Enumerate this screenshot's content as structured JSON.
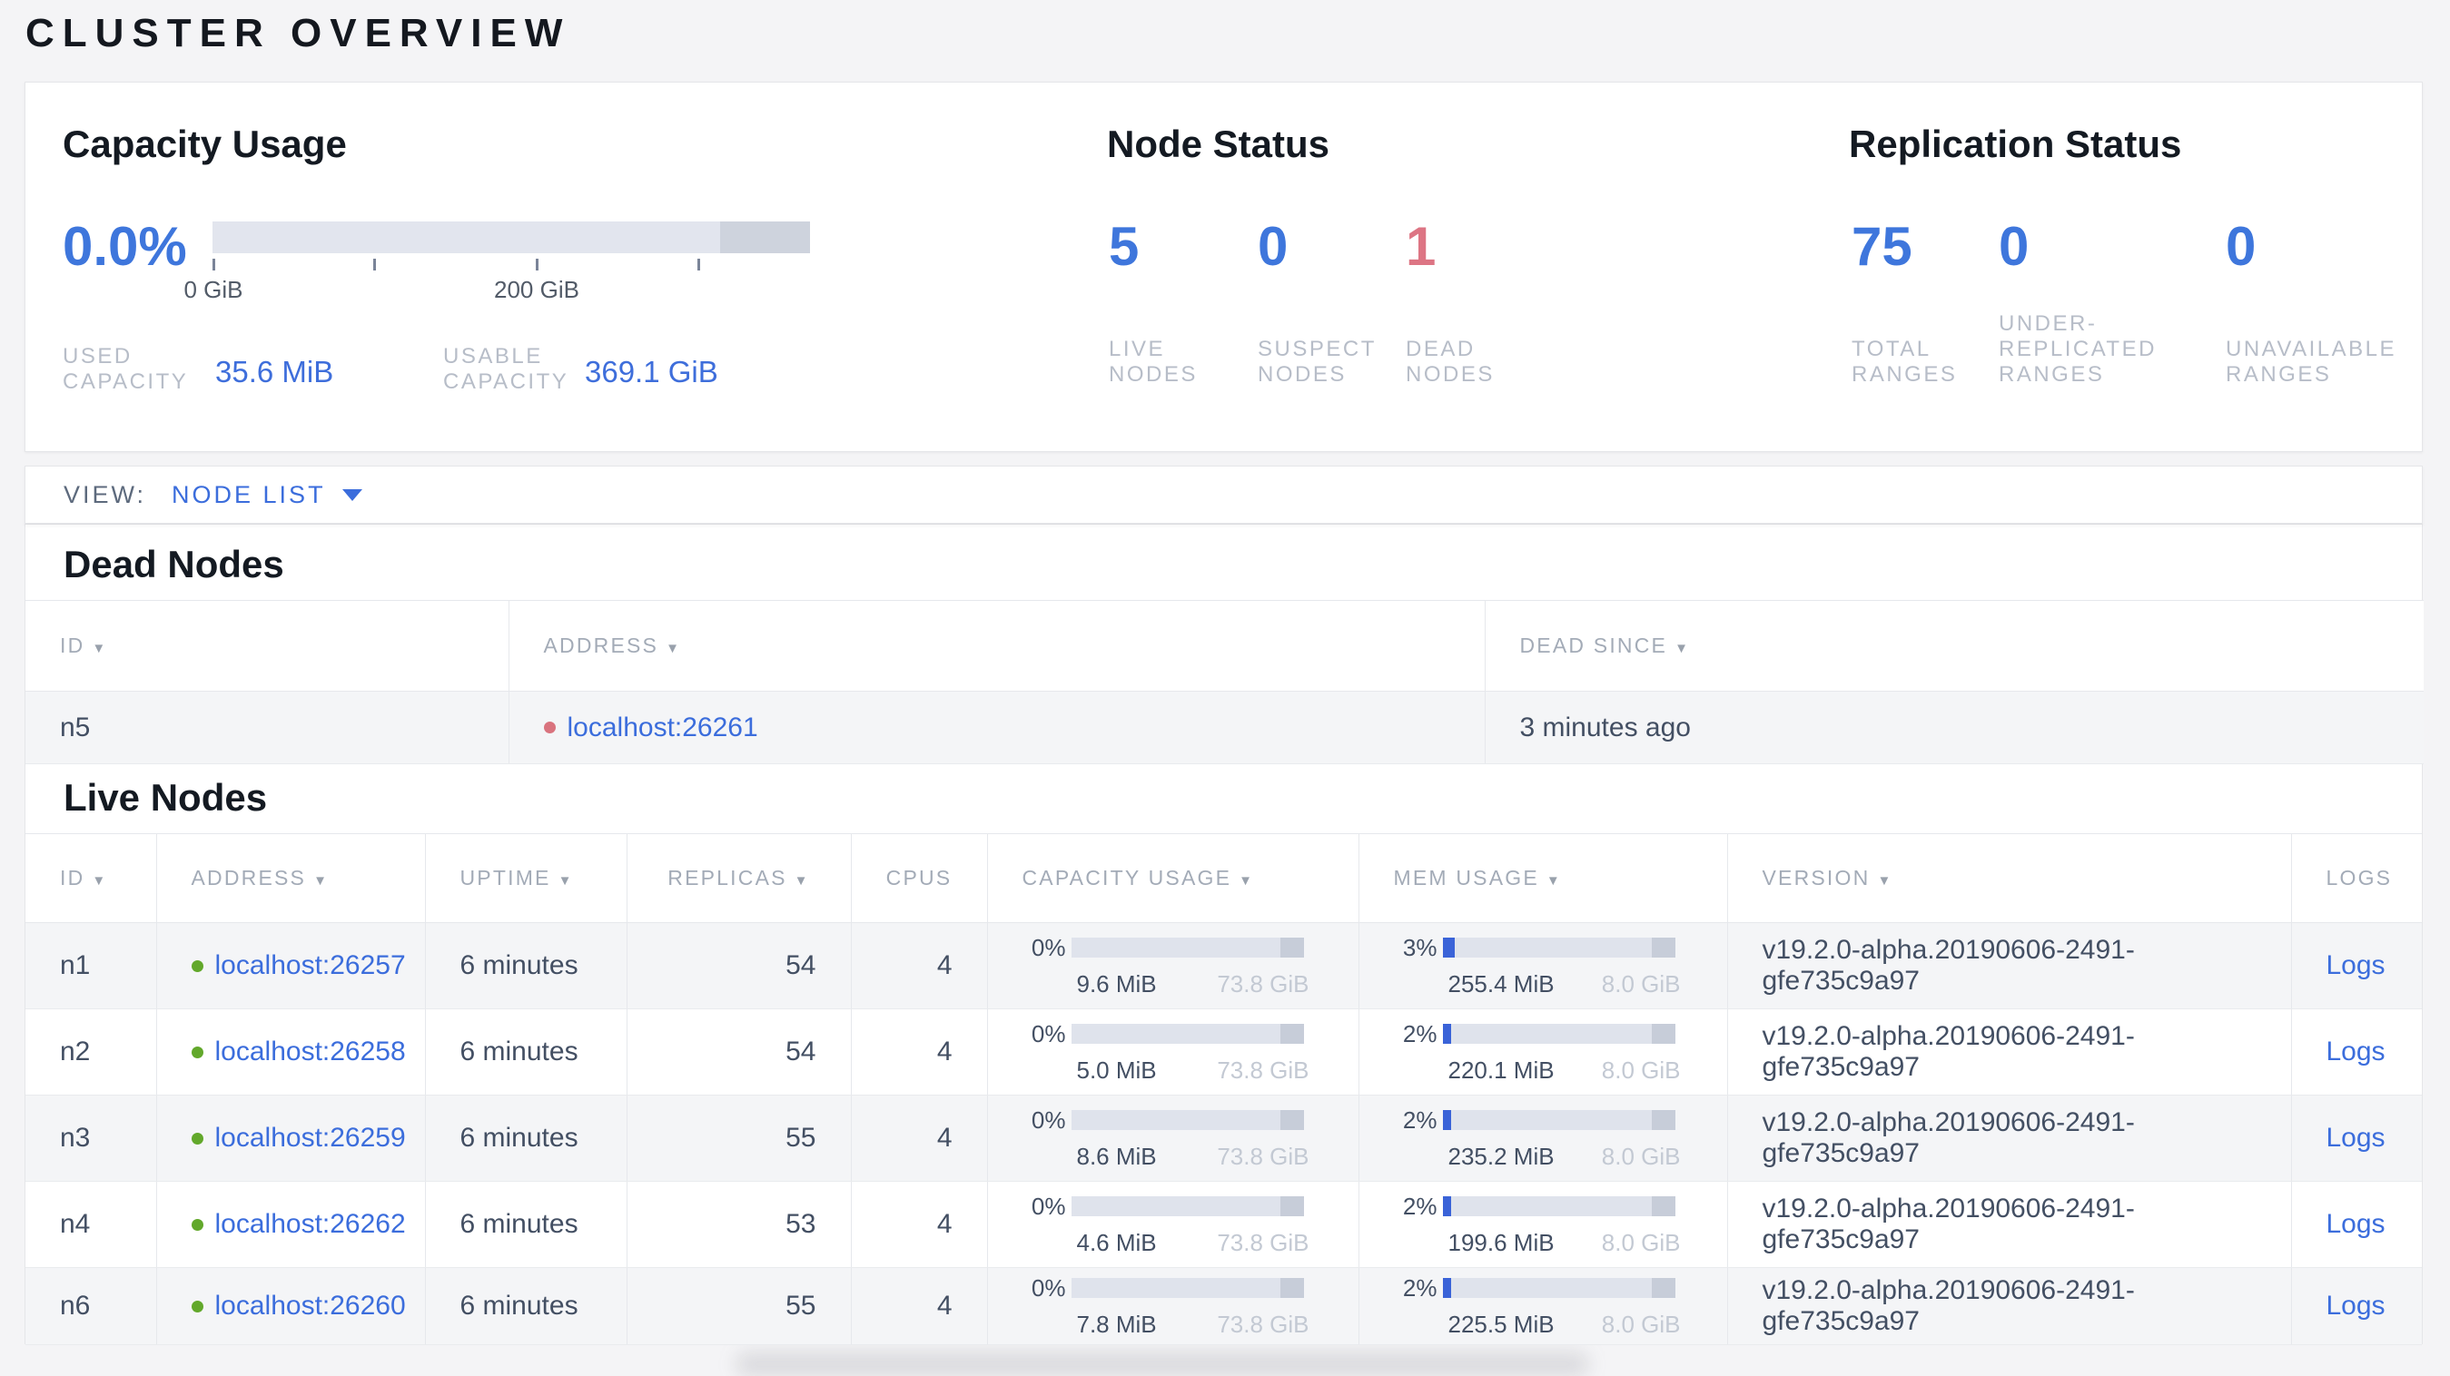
{
  "colors": {
    "accent_blue": "#3e76dc",
    "link_blue": "#3b6ddc",
    "danger_red": "#dd7584",
    "live_green": "#62a82b",
    "dead_dot_red": "#d9737e"
  },
  "page": {
    "title": "CLUSTER OVERVIEW"
  },
  "summary": {
    "capacity": {
      "title": "Capacity Usage",
      "percent": "0.0%",
      "axis_tick_0": "0 GiB",
      "axis_tick_200": "200 GiB",
      "bar": {
        "max_gib": 369.1,
        "used_fraction": 0,
        "reserved_start_fraction": 0.85
      },
      "used_label": "USED\nCAPACITY",
      "used_value": "35.6 MiB",
      "usable_label": "USABLE\nCAPACITY",
      "usable_value": "369.1 GiB"
    },
    "node_status": {
      "title": "Node Status",
      "live_value": "5",
      "live_label": "LIVE\nNODES",
      "suspect_value": "0",
      "suspect_label": "SUSPECT\nNODES",
      "dead_value": "1",
      "dead_label": "DEAD\nNODES"
    },
    "replication": {
      "title": "Replication Status",
      "total_value": "75",
      "total_label": "TOTAL\nRANGES",
      "under_value": "0",
      "under_label": "UNDER-\nREPLICATED\nRANGES",
      "unavailable_value": "0",
      "unavailable_label": "UNAVAILABLE\nRANGES"
    }
  },
  "view_bar": {
    "label": "VIEW:",
    "selected": "NODE LIST"
  },
  "dead_nodes": {
    "title": "Dead Nodes",
    "columns": {
      "id": "ID",
      "address": "ADDRESS",
      "dead_since": "DEAD SINCE"
    },
    "rows": [
      {
        "id": "n5",
        "address": "localhost:26261",
        "dead_since": "3 minutes ago"
      }
    ]
  },
  "live_nodes": {
    "title": "Live Nodes",
    "columns": {
      "id": "ID",
      "address": "ADDRESS",
      "uptime": "UPTIME",
      "replicas": "REPLICAS",
      "cpus": "CPUS",
      "capacity": "CAPACITY USAGE",
      "mem": "MEM USAGE",
      "version": "VERSION",
      "logs": "LOGS"
    },
    "rows": [
      {
        "id": "n1",
        "address": "localhost:26257",
        "uptime": "6 minutes",
        "replicas": "54",
        "cpus": "4",
        "cap_pct": "0%",
        "cap_pct_num": 0,
        "cap_used": "9.6 MiB",
        "cap_total": "73.8 GiB",
        "mem_pct": "3%",
        "mem_pct_num": 3,
        "mem_used": "255.4 MiB",
        "mem_total": "8.0 GiB",
        "version": "v19.2.0-alpha.20190606-2491-gfe735c9a97",
        "logs": "Logs"
      },
      {
        "id": "n2",
        "address": "localhost:26258",
        "uptime": "6 minutes",
        "replicas": "54",
        "cpus": "4",
        "cap_pct": "0%",
        "cap_pct_num": 0,
        "cap_used": "5.0 MiB",
        "cap_total": "73.8 GiB",
        "mem_pct": "2%",
        "mem_pct_num": 2,
        "mem_used": "220.1 MiB",
        "mem_total": "8.0 GiB",
        "version": "v19.2.0-alpha.20190606-2491-gfe735c9a97",
        "logs": "Logs"
      },
      {
        "id": "n3",
        "address": "localhost:26259",
        "uptime": "6 minutes",
        "replicas": "55",
        "cpus": "4",
        "cap_pct": "0%",
        "cap_pct_num": 0,
        "cap_used": "8.6 MiB",
        "cap_total": "73.8 GiB",
        "mem_pct": "2%",
        "mem_pct_num": 2,
        "mem_used": "235.2 MiB",
        "mem_total": "8.0 GiB",
        "version": "v19.2.0-alpha.20190606-2491-gfe735c9a97",
        "logs": "Logs"
      },
      {
        "id": "n4",
        "address": "localhost:26262",
        "uptime": "6 minutes",
        "replicas": "53",
        "cpus": "4",
        "cap_pct": "0%",
        "cap_pct_num": 0,
        "cap_used": "4.6 MiB",
        "cap_total": "73.8 GiB",
        "mem_pct": "2%",
        "mem_pct_num": 2,
        "mem_used": "199.6 MiB",
        "mem_total": "8.0 GiB",
        "version": "v19.2.0-alpha.20190606-2491-gfe735c9a97",
        "logs": "Logs"
      },
      {
        "id": "n6",
        "address": "localhost:26260",
        "uptime": "6 minutes",
        "replicas": "55",
        "cpus": "4",
        "cap_pct": "0%",
        "cap_pct_num": 0,
        "cap_used": "7.8 MiB",
        "cap_total": "73.8 GiB",
        "mem_pct": "2%",
        "mem_pct_num": 2,
        "mem_used": "225.5 MiB",
        "mem_total": "8.0 GiB",
        "version": "v19.2.0-alpha.20190606-2491-gfe735c9a97",
        "logs": "Logs"
      }
    ]
  }
}
